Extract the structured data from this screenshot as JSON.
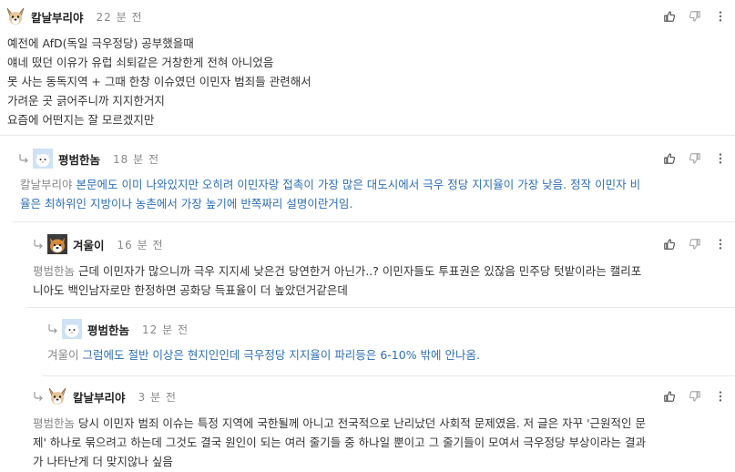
{
  "comments": [
    {
      "nickname": "칼날부리야",
      "time": "22 분 전",
      "lines": [
        "예전에 AfD(독일 극우정당) 공부했을때",
        "얘네 떴던 이유가 유럽 쇠퇴같은 거창한게 전혀 아니었음",
        "못 사는 동독지역 + 그때 한창 이슈였던 이민자 범죄들 관련해서",
        "가려운 곳 긁어주니까 지지한거지",
        "요즘에 어떤지는 잘 모르겠지만"
      ]
    },
    {
      "nickname": "평범한놈",
      "time": "18 분 전",
      "mention": "칼날부리야",
      "line1": "본문에도 이미 나와있지만 오히려 이민자랑 접촉이 가장 많은 대도시에서 극우 정당 지지율이 가장 낮음. 정작 이민자 비",
      "line2": "율은 최하위인 지방이나 농촌에서 가장 높기에 반쪽짜리 설명이란거임."
    },
    {
      "nickname": "겨울이",
      "time": "16 분 전",
      "mention": "평범한놈",
      "line1": "근데 이민자가 많으니까 극우 지지세 낮은건 당연한거 아닌가..? 이민자들도 투표권은 있잖음 민주당 텃밭이라는 캘리포",
      "line2": "니아도 백인남자로만 한정하면 공화당 득표율이 더 높았던거같은데"
    },
    {
      "nickname": "평범한놈",
      "time": "12 분 전",
      "mention": "겨울이",
      "line1": "그럼에도 절반 이상은 현지인인데 극우정당 지지율이 파리등은 6-10% 밖에 안나옴."
    },
    {
      "nickname": "칼날부리야",
      "time": "3 분 전",
      "mention": "평범한놈",
      "line1": "당시 이민자 범죄 이슈는 특정 지역에 국한될께 아니고 전국적으로 난리났던 사회적 문제였음. 저 글은 자꾸 '근원적인 문",
      "line2": "제' 하나로 묶으려고 하는데 그것도 결국 원인이 되는 여러 줄기들 중 하나일 뿐이고 그 줄기들이 모여서 극우정당 부상이라는 결과",
      "line3": "가 나타난게 더 맞지않나 싶음"
    }
  ],
  "icons": {
    "like": "thumbs-up-icon",
    "dislike": "thumbs-down-icon",
    "more": "more-vertical-icon",
    "reply": "reply-arrow-icon"
  },
  "colors": {
    "link_blue": "#2f6fb5",
    "meta_gray": "#888888",
    "divider": "#e9e9e9"
  }
}
